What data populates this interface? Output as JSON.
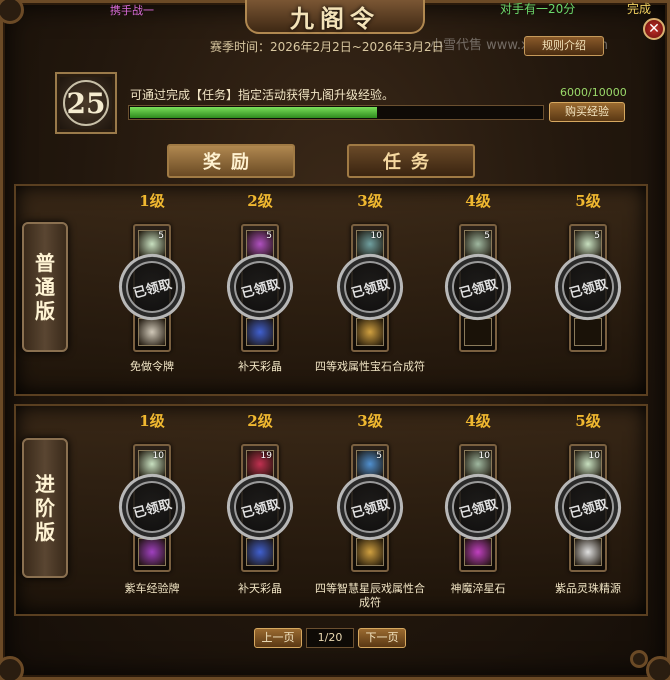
{
  "window": {
    "title": "九阁令",
    "close_icon": "close-icon"
  },
  "top_overlay": {
    "left_text": "携手战一",
    "right_text": "对手有一20分",
    "right_text2": "完成"
  },
  "season": {
    "label": "赛季时间：2026年2月2日~2026年3月2日",
    "watermark": "小雪代售 www.xxds777.com",
    "rules_button": "规则介绍"
  },
  "level": {
    "value": "25"
  },
  "progress": {
    "description": "可通过完成【任务】指定活动获得九阁升级经验。",
    "text": "6000/10000",
    "fraction": 0.6,
    "buy_button": "购买经验"
  },
  "tabs": [
    {
      "label": "奖励",
      "active": true
    },
    {
      "label": "任务",
      "active": false
    }
  ],
  "sections": [
    {
      "side_label": "普通版",
      "levels": [
        {
          "title": "1级",
          "top_qty": "5",
          "top_color": "#c8e0c0",
          "bottom_qty": "",
          "bottom_color": "#d0c8b8",
          "stamp": "已领取",
          "name": "免做令牌"
        },
        {
          "title": "2级",
          "top_qty": "5",
          "top_color": "#b050c0",
          "bottom_qty": "",
          "bottom_color": "#4060d0",
          "stamp": "已领取",
          "name": "补天彩晶"
        },
        {
          "title": "3级",
          "top_qty": "10",
          "top_color": "#70a0a0",
          "bottom_qty": "",
          "bottom_color": "#d0a040",
          "stamp": "已领取",
          "name": "四等戏属性宝石合成符"
        },
        {
          "title": "4级",
          "top_qty": "5",
          "top_color": "#a0b8a0",
          "bottom_qty": "",
          "bottom_color": "",
          "stamp": "已领取",
          "name": ""
        },
        {
          "title": "5级",
          "top_qty": "5",
          "top_color": "#c8e0c0",
          "bottom_qty": "",
          "bottom_color": "",
          "stamp": "已领取",
          "name": ""
        }
      ]
    },
    {
      "side_label": "进阶版",
      "levels": [
        {
          "title": "1级",
          "top_qty": "10",
          "top_color": "#c8e0c0",
          "bottom_qty": "",
          "bottom_color": "#a040c0",
          "stamp": "已领取",
          "name": "紫车经验牌"
        },
        {
          "title": "2级",
          "top_qty": "19",
          "top_color": "#c03050",
          "bottom_qty": "",
          "bottom_color": "#4060d0",
          "stamp": "已领取",
          "name": "补天彩晶"
        },
        {
          "title": "3级",
          "top_qty": "5",
          "top_color": "#5090d0",
          "bottom_qty": "",
          "bottom_color": "#d0a040",
          "stamp": "已领取",
          "name": "四等智慧星辰戏属性合成符"
        },
        {
          "title": "4级",
          "top_qty": "10",
          "top_color": "#a0b8a0",
          "bottom_qty": "",
          "bottom_color": "#c040c0",
          "stamp": "已领取",
          "name": "神魔淬星石"
        },
        {
          "title": "5级",
          "top_qty": "10",
          "top_color": "#c8e0c0",
          "bottom_qty": "",
          "bottom_color": "#e0e0e0",
          "stamp": "已领取",
          "name": "紫品灵珠精源"
        }
      ]
    }
  ],
  "pagination": {
    "prev": "上一页",
    "page": "1/20",
    "next": "下一页"
  }
}
